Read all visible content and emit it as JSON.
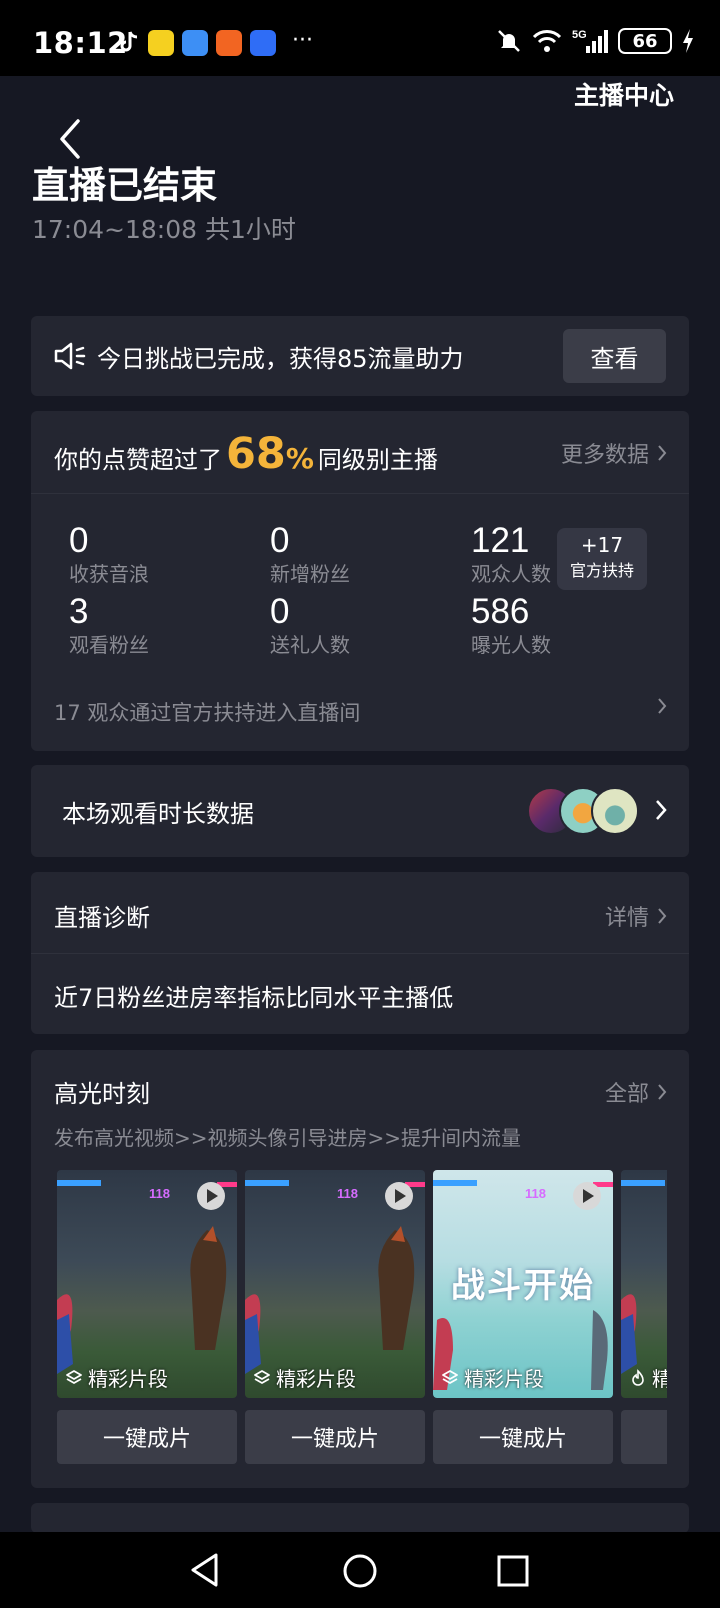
{
  "status_bar": {
    "time": "18:12",
    "battery": "66",
    "network": "5G",
    "app_icons": [
      "tiktok-icon",
      "qq-music-icon",
      "weather-icon",
      "red-packet-icon",
      "app-market-icon"
    ]
  },
  "header": {
    "back_icon": "back-arrow-icon",
    "anchor_center": "主播中心",
    "title": "直播已结束",
    "subtitle": "17:04~18:08 共1小时"
  },
  "challenge": {
    "icon": "speaker-icon",
    "text": "今日挑战已完成，获得85流量助力",
    "button": "查看"
  },
  "stats": {
    "head_prefix": "你的点赞超过了",
    "percent": "68",
    "percent_sign": "%",
    "head_suffix": "同级别主播",
    "more": "更多数据",
    "metrics": [
      {
        "value": "0",
        "label": "收获音浪"
      },
      {
        "value": "0",
        "label": "新增粉丝"
      },
      {
        "value": "121",
        "label": "观众人数"
      },
      {
        "value": "3",
        "label": "观看粉丝"
      },
      {
        "value": "0",
        "label": "送礼人数"
      },
      {
        "value": "586",
        "label": "曝光人数"
      }
    ],
    "boost_value": "+17",
    "boost_label": "官方扶持",
    "footer": "17 观众通过官方扶持进入直播间"
  },
  "watch": {
    "label": "本场观看时长数据"
  },
  "diagnosis": {
    "title": "直播诊断",
    "more": "详情",
    "text": "近7日粉丝进房率指标比同水平主播低"
  },
  "highlights": {
    "title": "高光时刻",
    "more": "全部",
    "desc": "发布高光视频>>视频头像引导进房>>提升间内流量",
    "clips": [
      {
        "tag": "精彩片段",
        "button": "一键成片",
        "overlay": "",
        "level": "118"
      },
      {
        "tag": "精彩片段",
        "button": "一键成片",
        "overlay": "",
        "level": "118"
      },
      {
        "tag": "精彩片段",
        "button": "一键成片",
        "overlay": "战斗开始",
        "level": "118"
      },
      {
        "tag": "精",
        "button": "",
        "overlay": "",
        "level": ""
      }
    ]
  },
  "colors": {
    "background": "#161823",
    "card": "#242631",
    "accent_percent": "#f4b43a",
    "muted_text": "#8a8b93"
  }
}
